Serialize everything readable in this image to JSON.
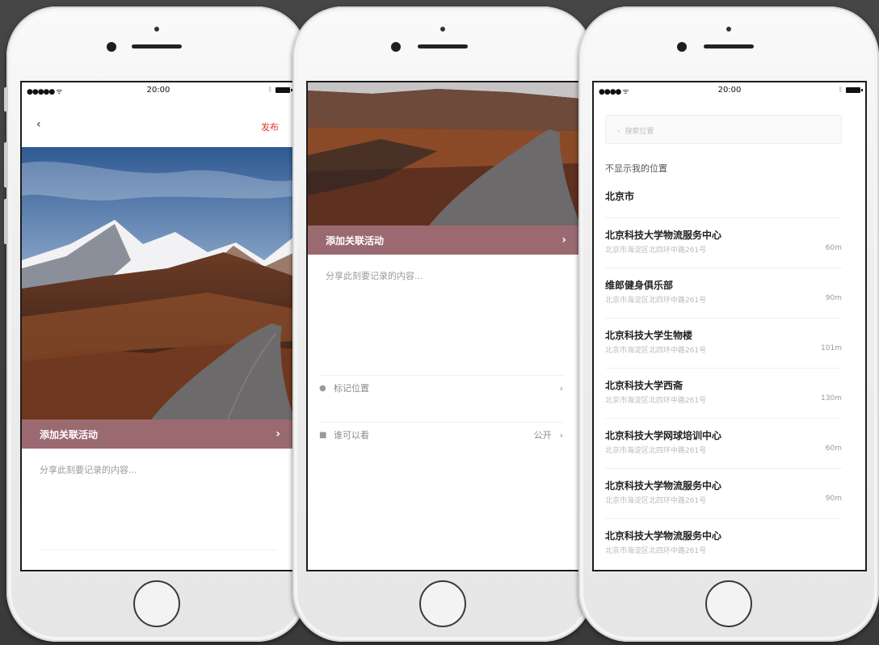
{
  "status": {
    "time": "20:00",
    "signal": "●●●●● ᯤ",
    "signal2": "●●●● ᯤ"
  },
  "post": {
    "back_icon": "chevron-left-icon",
    "publish_label": "发布",
    "activity_label": "添加关联活动",
    "share_placeholder": "分享此刻要记录的内容..."
  },
  "post2": {
    "activity_label": "添加关联活动",
    "share_placeholder": "分享此刻要记录的内容...",
    "location_label": "标记位置",
    "visibility_label": "谁可以看",
    "visibility_value": "公开"
  },
  "location": {
    "search_placeholder": "搜索位置",
    "hide_label": "不显示我的位置",
    "city": "北京市",
    "items": [
      {
        "name": "北京科技大学物流服务中心",
        "address": "北京市海淀区北四环中路261号",
        "distance": "60m"
      },
      {
        "name": "维郎健身俱乐部",
        "address": "北京市海淀区北四环中路261号",
        "distance": "90m"
      },
      {
        "name": "北京科技大学生物楼",
        "address": "北京市海淀区北四环中路261号",
        "distance": "101m"
      },
      {
        "name": "北京科技大学西斋",
        "address": "北京市海淀区北四环中路261号",
        "distance": "130m"
      },
      {
        "name": "北京科技大学网球培训中心",
        "address": "北京市海淀区北四环中路261号",
        "distance": "60m"
      },
      {
        "name": "北京科技大学物流服务中心",
        "address": "北京市海淀区北四环中路261号",
        "distance": "90m"
      },
      {
        "name": "北京科技大学物流服务中心",
        "address": "北京市海淀区北四环中路261号",
        "distance": ""
      }
    ]
  },
  "colors": {
    "accent": "#9b6a71",
    "publish": "#d9392c"
  }
}
